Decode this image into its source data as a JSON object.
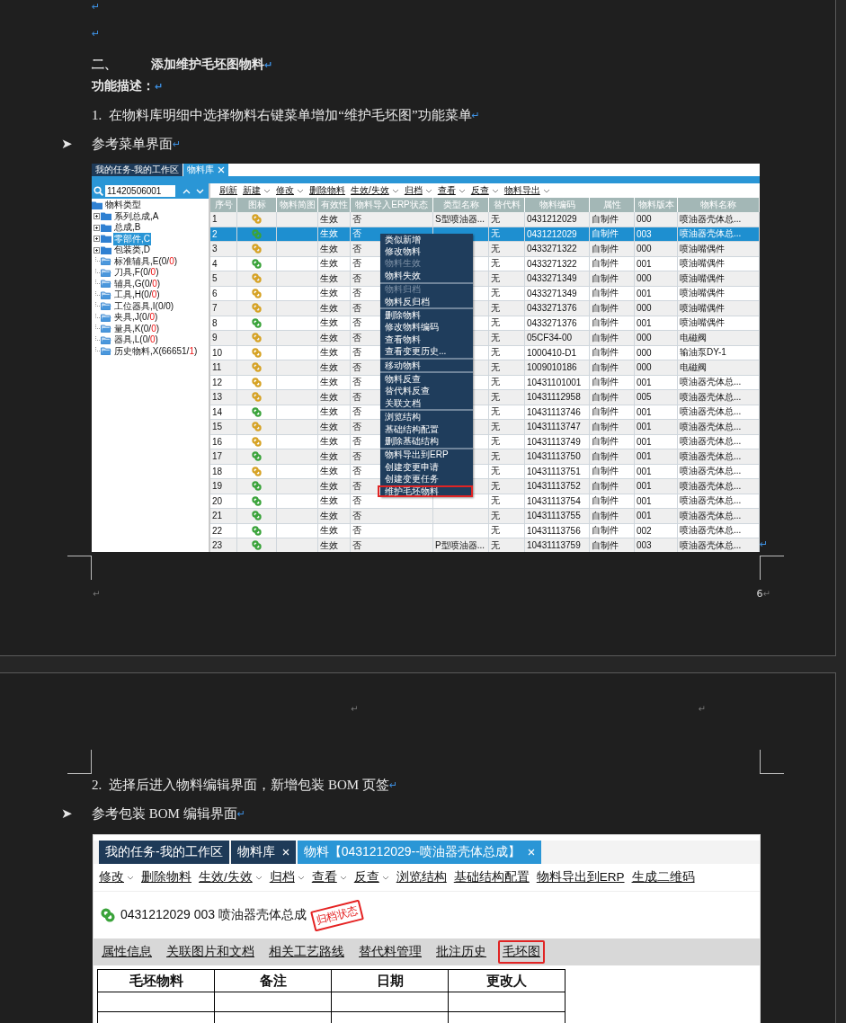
{
  "page1": {
    "paragraphs": [
      {
        "kind": "blank",
        "mark": "↵"
      },
      {
        "kind": "blank",
        "mark": "↵"
      },
      {
        "kind": "heading",
        "number": "二、",
        "text": "添加维护毛坯图物料",
        "mark": "↵"
      },
      {
        "kind": "label",
        "text": "功能描述：",
        "mark": "↵"
      },
      {
        "kind": "numbered",
        "number": "1.",
        "text": "在物料库明细中选择物料右键菜单增加“维护毛坯图”功能菜单",
        "mark": "↵"
      },
      {
        "kind": "bullet",
        "bullet": "➤",
        "text": "参考菜单界面",
        "mark": "↵"
      }
    ],
    "figure1": {
      "tabs": [
        {
          "label": "我的任务-我的工作区",
          "closable": false,
          "selected": false
        },
        {
          "label": "物料库",
          "closable": true,
          "selected": true
        }
      ],
      "search": {
        "value": "11420506001"
      },
      "tree": {
        "label": "物料类型",
        "selected": false,
        "children": [
          {
            "text": "系列总成,A",
            "expandable": true,
            "selected": false
          },
          {
            "text": "总成,B",
            "expandable": true,
            "selected": false
          },
          {
            "text": "零部件,C",
            "expandable": true,
            "selected": true
          },
          {
            "text": "包装类,D",
            "expandable": true,
            "selected": false
          },
          {
            "text": "标准辅具,E(0/",
            "red": "0",
            "tail": ")",
            "expandable": false,
            "selected": false
          },
          {
            "text": "刀具,F(0/",
            "red": "0",
            "tail": ")",
            "expandable": false,
            "selected": false
          },
          {
            "text": "辅具,G(0/",
            "red": "0",
            "tail": ")",
            "expandable": false,
            "selected": false
          },
          {
            "text": "工具,H(0/",
            "red": "0",
            "tail": ")",
            "expandable": false,
            "selected": false
          },
          {
            "text": "工位器具,I(0/0)",
            "expandable": false,
            "selected": false
          },
          {
            "text": "夹具,J(0/",
            "red": "0",
            "tail": ")",
            "expandable": false,
            "selected": false
          },
          {
            "text": "量具,K(0/",
            "red": "0",
            "tail": ")",
            "expandable": false,
            "selected": false
          },
          {
            "text": "器具,L(0/",
            "red": "0",
            "tail": ")",
            "expandable": false,
            "selected": false
          },
          {
            "text": "历史物料,X(66651/",
            "red": "1",
            "tail": ")",
            "expandable": false,
            "selected": false
          }
        ]
      },
      "toolbar": [
        {
          "label": "刷新",
          "dropdown": false
        },
        {
          "label": "新建",
          "dropdown": true
        },
        {
          "label": "修改",
          "dropdown": true
        },
        {
          "label": "删除物料",
          "dropdown": false
        },
        {
          "label": "生效/失效",
          "dropdown": true
        },
        {
          "label": "归档",
          "dropdown": true
        },
        {
          "label": "查看",
          "dropdown": true
        },
        {
          "label": "反查",
          "dropdown": true
        },
        {
          "label": "物料导出",
          "dropdown": true
        }
      ],
      "columns": [
        "序号",
        "图标",
        "物料简图",
        "有效性",
        "物料导入ERP状态",
        "类型名称",
        "替代料",
        "物料编码",
        "属性",
        "物料版本",
        "物料名称"
      ],
      "rows": [
        {
          "no": "1",
          "color": "#d6a224",
          "validity": "生效",
          "erp": "否",
          "type": "S型喷油器...",
          "alt": "无",
          "code": "0431212029",
          "attr": "自制件",
          "version": "000",
          "name": "喷油器壳体总...",
          "selected": false
        },
        {
          "no": "2",
          "color": "#3aa33a",
          "validity": "生效",
          "erp": "否",
          "alt": "无",
          "code": "0431212029",
          "attr": "自制件",
          "version": "003",
          "name": "喷油器壳体总...",
          "selected": true
        },
        {
          "no": "3",
          "color": "#d6a224",
          "validity": "生效",
          "erp": "否",
          "alt": "无",
          "code": "0433271322",
          "attr": "自制件",
          "version": "000",
          "name": "喷油嘴偶件",
          "selected": false
        },
        {
          "no": "4",
          "color": "#3aa33a",
          "validity": "生效",
          "erp": "否",
          "alt": "无",
          "code": "0433271322",
          "attr": "自制件",
          "version": "001",
          "name": "喷油嘴偶件",
          "selected": false
        },
        {
          "no": "5",
          "color": "#d6a224",
          "validity": "生效",
          "erp": "否",
          "alt": "无",
          "code": "0433271349",
          "attr": "自制件",
          "version": "000",
          "name": "喷油嘴偶件",
          "selected": false
        },
        {
          "no": "6",
          "color": "#d6a224",
          "validity": "生效",
          "erp": "否",
          "alt": "无",
          "code": "0433271349",
          "attr": "自制件",
          "version": "001",
          "name": "喷油嘴偶件",
          "selected": false
        },
        {
          "no": "7",
          "color": "#d6a224",
          "validity": "生效",
          "erp": "否",
          "alt": "无",
          "code": "0433271376",
          "attr": "自制件",
          "version": "000",
          "name": "喷油嘴偶件",
          "selected": false
        },
        {
          "no": "8",
          "color": "#3aa33a",
          "validity": "生效",
          "erp": "否",
          "alt": "无",
          "code": "0433271376",
          "attr": "自制件",
          "version": "001",
          "name": "喷油嘴偶件",
          "selected": false
        },
        {
          "no": "9",
          "color": "#d6a224",
          "validity": "生效",
          "erp": "否",
          "alt": "无",
          "code": "05CF34-00",
          "attr": "自制件",
          "version": "000",
          "name": "电磁阀",
          "selected": false
        },
        {
          "no": "10",
          "color": "#d6a224",
          "validity": "生效",
          "erp": "否",
          "alt": "无",
          "code": "1000410-D1",
          "attr": "自制件",
          "version": "000",
          "name": "输油泵DY-1",
          "selected": false
        },
        {
          "no": "11",
          "color": "#d6a224",
          "validity": "生效",
          "erp": "否",
          "alt": "无",
          "code": "1009010186",
          "attr": "自制件",
          "version": "000",
          "name": "电磁阀",
          "selected": false
        },
        {
          "no": "12",
          "color": "#d6a224",
          "validity": "生效",
          "erp": "否",
          "alt": "无",
          "code": "10431101001",
          "attr": "自制件",
          "version": "001",
          "name": "喷油器壳体总...",
          "selected": false
        },
        {
          "no": "13",
          "color": "#d6a224",
          "validity": "生效",
          "erp": "否",
          "alt": "无",
          "code": "10431112958",
          "attr": "自制件",
          "version": "005",
          "name": "喷油器壳体总...",
          "selected": false
        },
        {
          "no": "14",
          "color": "#3aa33a",
          "validity": "生效",
          "erp": "否",
          "alt": "无",
          "code": "10431113746",
          "attr": "自制件",
          "version": "001",
          "name": "喷油器壳体总...",
          "selected": false
        },
        {
          "no": "15",
          "color": "#d6a224",
          "validity": "生效",
          "erp": "否",
          "alt": "无",
          "code": "10431113747",
          "attr": "自制件",
          "version": "001",
          "name": "喷油器壳体总...",
          "selected": false
        },
        {
          "no": "16",
          "color": "#d6a224",
          "validity": "生效",
          "erp": "否",
          "alt": "无",
          "code": "10431113749",
          "attr": "自制件",
          "version": "001",
          "name": "喷油器壳体总...",
          "selected": false
        },
        {
          "no": "17",
          "color": "#3aa33a",
          "validity": "生效",
          "erp": "否",
          "alt": "无",
          "code": "10431113750",
          "attr": "自制件",
          "version": "001",
          "name": "喷油器壳体总...",
          "selected": false
        },
        {
          "no": "18",
          "color": "#d6a224",
          "validity": "生效",
          "erp": "否",
          "alt": "无",
          "code": "10431113751",
          "attr": "自制件",
          "version": "001",
          "name": "喷油器壳体总...",
          "selected": false
        },
        {
          "no": "19",
          "color": "#3aa33a",
          "validity": "生效",
          "erp": "否",
          "alt": "无",
          "code": "10431113752",
          "attr": "自制件",
          "version": "001",
          "name": "喷油器壳体总...",
          "selected": false
        },
        {
          "no": "20",
          "color": "#3aa33a",
          "validity": "生效",
          "erp": "否",
          "alt": "无",
          "code": "10431113754",
          "attr": "自制件",
          "version": "001",
          "name": "喷油器壳体总...",
          "selected": false
        },
        {
          "no": "21",
          "color": "#3aa33a",
          "validity": "生效",
          "erp": "否",
          "alt": "无",
          "code": "10431113755",
          "attr": "自制件",
          "version": "001",
          "name": "喷油器壳体总...",
          "selected": false
        },
        {
          "no": "22",
          "color": "#3aa33a",
          "validity": "生效",
          "erp": "否",
          "alt": "无",
          "code": "10431113756",
          "attr": "自制件",
          "version": "002",
          "name": "喷油器壳体总...",
          "selected": false
        },
        {
          "no": "23",
          "color": "#3aa33a",
          "validity": "生效",
          "erp": "否",
          "type": "P型喷油器...",
          "alt": "无",
          "code": "10431113759",
          "attr": "自制件",
          "version": "003",
          "name": "喷油器壳体总...",
          "selected": false
        }
      ],
      "menu": {
        "groups": [
          {
            "items": [
              {
                "label": "类似新增",
                "disabled": false,
                "highlighted": false
              },
              {
                "label": "修改物料",
                "disabled": false,
                "highlighted": false
              },
              {
                "label": "物料生效",
                "disabled": true,
                "highlighted": false
              },
              {
                "label": "物料失效",
                "disabled": false,
                "highlighted": false
              }
            ]
          },
          {
            "items": [
              {
                "label": "物料归档",
                "disabled": true,
                "highlighted": false
              },
              {
                "label": "物料反归档",
                "disabled": false,
                "highlighted": false
              }
            ]
          },
          {
            "items": [
              {
                "label": "删除物料",
                "disabled": false,
                "highlighted": false
              },
              {
                "label": "修改物料编码",
                "disabled": false,
                "highlighted": false
              },
              {
                "label": "查看物料",
                "disabled": false,
                "highlighted": false
              },
              {
                "label": "查看变更历史...",
                "disabled": false,
                "highlighted": false
              }
            ]
          },
          {
            "items": [
              {
                "label": "移动物料",
                "disabled": false,
                "highlighted": false
              }
            ]
          },
          {
            "items": [
              {
                "label": "物料反查",
                "disabled": false,
                "highlighted": false
              },
              {
                "label": "替代料反查",
                "disabled": false,
                "highlighted": false
              },
              {
                "label": "关联文档",
                "disabled": false,
                "highlighted": false
              }
            ]
          },
          {
            "items": [
              {
                "label": "浏览结构",
                "disabled": false,
                "highlighted": false
              },
              {
                "label": "基础结构配置",
                "disabled": false,
                "highlighted": false
              },
              {
                "label": "删除基础结构",
                "disabled": false,
                "highlighted": false
              }
            ]
          },
          {
            "items": [
              {
                "label": "物料导出到ERP",
                "disabled": false,
                "highlighted": false
              },
              {
                "label": "创建变更申请",
                "disabled": false,
                "highlighted": false
              },
              {
                "label": "创建变更任务",
                "disabled": false,
                "highlighted": false
              },
              {
                "label": "维护毛坯物料",
                "disabled": false,
                "highlighted": true
              }
            ]
          }
        ]
      }
    },
    "figure_mark": "↵",
    "footer": {
      "mark": "↵",
      "page_number": "6",
      "number_mark": "↵"
    }
  },
  "page2": {
    "header_marks": [
      "↵",
      "↵"
    ],
    "paragraphs": [
      {
        "kind": "numbered",
        "number": "2.",
        "text": "选择后进入物料编辑界面，新增包装 BOM 页签",
        "mark": "↵"
      },
      {
        "kind": "bullet",
        "bullet": "➤",
        "text": "参考包装 BOM 编辑界面",
        "mark": "↵"
      }
    ],
    "figure2": {
      "tabs": [
        {
          "label": "我的任务-我的工作区",
          "closable": false,
          "selected": false
        },
        {
          "label": "物料库",
          "closable": true,
          "selected": false
        },
        {
          "label": "物料【0431212029--喷油器壳体总成】",
          "closable": true,
          "selected": true
        }
      ],
      "toolbar": [
        {
          "label": "修改",
          "dropdown": true
        },
        {
          "label": "删除物料",
          "dropdown": false
        },
        {
          "label": "生效/失效",
          "dropdown": true
        },
        {
          "label": "归档",
          "dropdown": true
        },
        {
          "label": "查看",
          "dropdown": true
        },
        {
          "label": "反查",
          "dropdown": true
        },
        {
          "label": "浏览结构",
          "dropdown": false
        },
        {
          "label": "基础结构配置",
          "dropdown": false
        },
        {
          "label": "物料导出到ERP",
          "dropdown": false
        },
        {
          "label": "生成二维码",
          "dropdown": false
        }
      ],
      "material": {
        "title": "0431212029 003 喷油器壳体总成",
        "stamp": "归档状态"
      },
      "subtabs": [
        {
          "label": "属性信息",
          "highlighted": false
        },
        {
          "label": "关联图片和文档",
          "highlighted": false
        },
        {
          "label": "相关工艺路线",
          "highlighted": false
        },
        {
          "label": "替代料管理",
          "highlighted": false
        },
        {
          "label": "批注历史",
          "highlighted": false
        },
        {
          "label": "毛坯图",
          "highlighted": true
        }
      ],
      "columns": [
        "毛坯物料",
        "备注",
        "日期",
        "更改人"
      ]
    }
  }
}
